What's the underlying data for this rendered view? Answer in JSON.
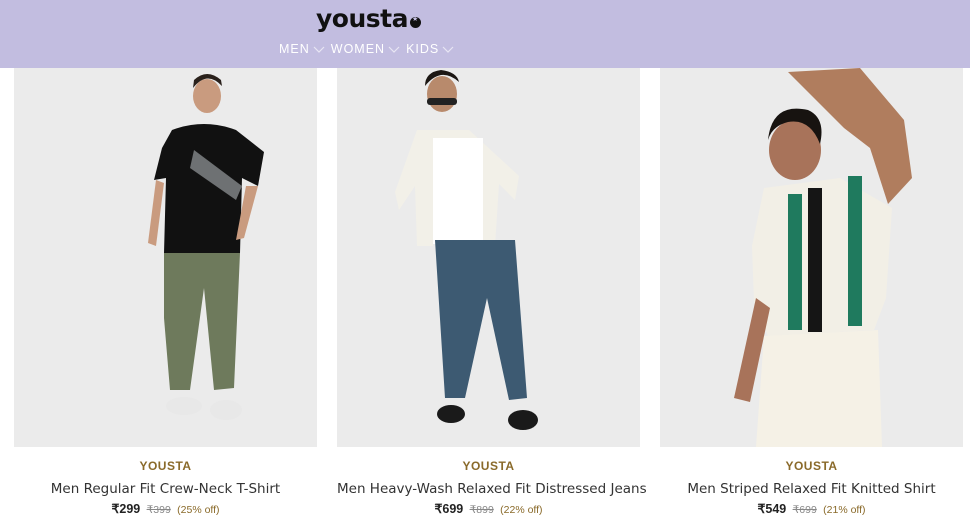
{
  "header": {
    "logo": "yousta",
    "nav": [
      {
        "label": "MEN"
      },
      {
        "label": "WOMEN"
      },
      {
        "label": "KIDS"
      }
    ],
    "background": "#c2bde0"
  },
  "products": [
    {
      "brand": "YOUSTA",
      "name": "Men Regular Fit Crew-Neck T-Shirt",
      "price": "₹299",
      "mrp": "₹399",
      "discount": "(25% off)"
    },
    {
      "brand": "YOUSTA",
      "name": "Men Heavy-Wash Relaxed Fit Distressed Jeans",
      "price": "₹699",
      "mrp": "₹899",
      "discount": "(22% off)"
    },
    {
      "brand": "YOUSTA",
      "name": "Men Striped Relaxed Fit Knitted Shirt",
      "price": "₹549",
      "mrp": "₹699",
      "discount": "(21% off)"
    }
  ],
  "colors": {
    "brand_text": "#8a6a2a",
    "image_bg": "#ebebeb"
  }
}
